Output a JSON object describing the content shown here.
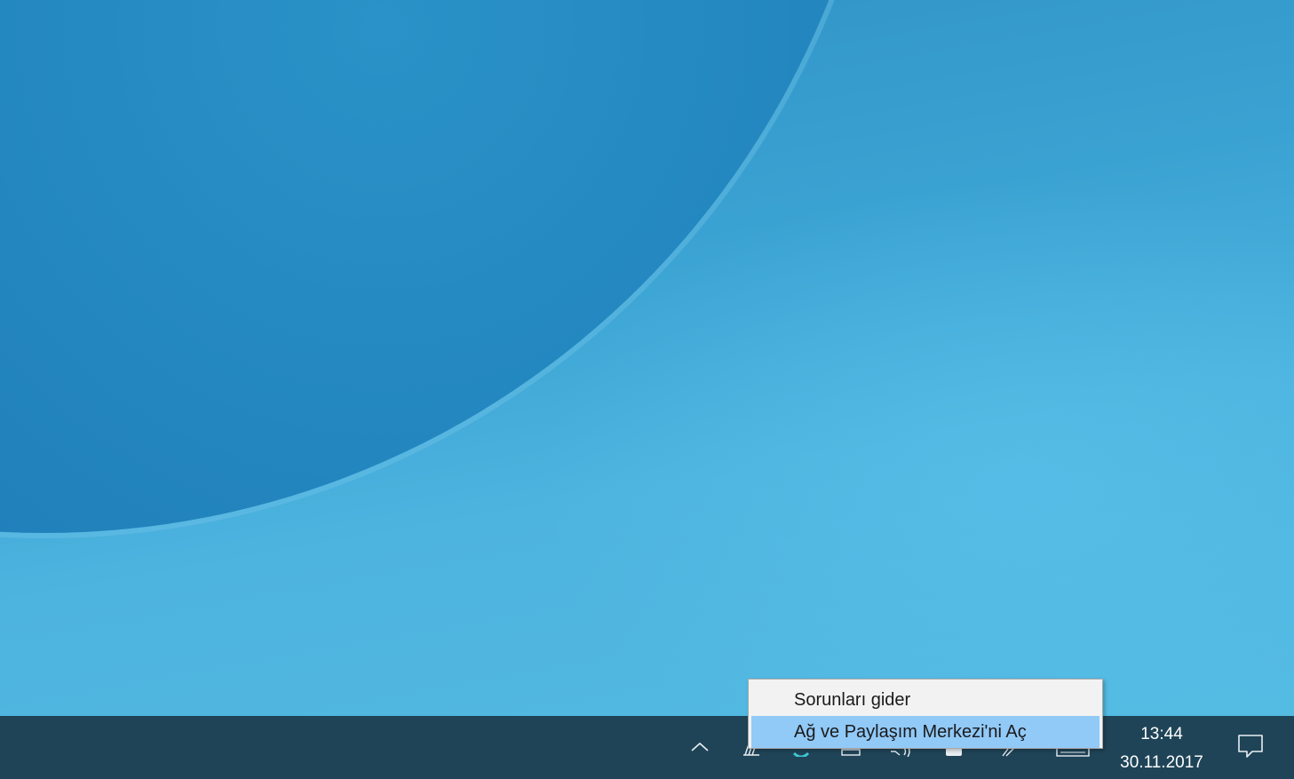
{
  "context_menu": {
    "items": [
      {
        "label": "Sorunları gider",
        "highlighted": false
      },
      {
        "label": "Ağ ve Paylaşım Merkezi'ni Aç",
        "highlighted": true
      }
    ],
    "highlight_color": "#91c9f7"
  },
  "taskbar": {
    "background_color": "#1f4457",
    "tray_icons": [
      "chevron-up-icon",
      "network-icon",
      "app-icon",
      "monitor-icon",
      "volume-icon",
      "battery-icon",
      "pen-icon",
      "keyboard-icon"
    ],
    "clock": {
      "time": "13:44",
      "date": "30.11.2017"
    },
    "notification_icon": "action-center-icon"
  },
  "wallpaper": {
    "accent_light": "#55bce3",
    "accent_dark": "#0f5693"
  }
}
